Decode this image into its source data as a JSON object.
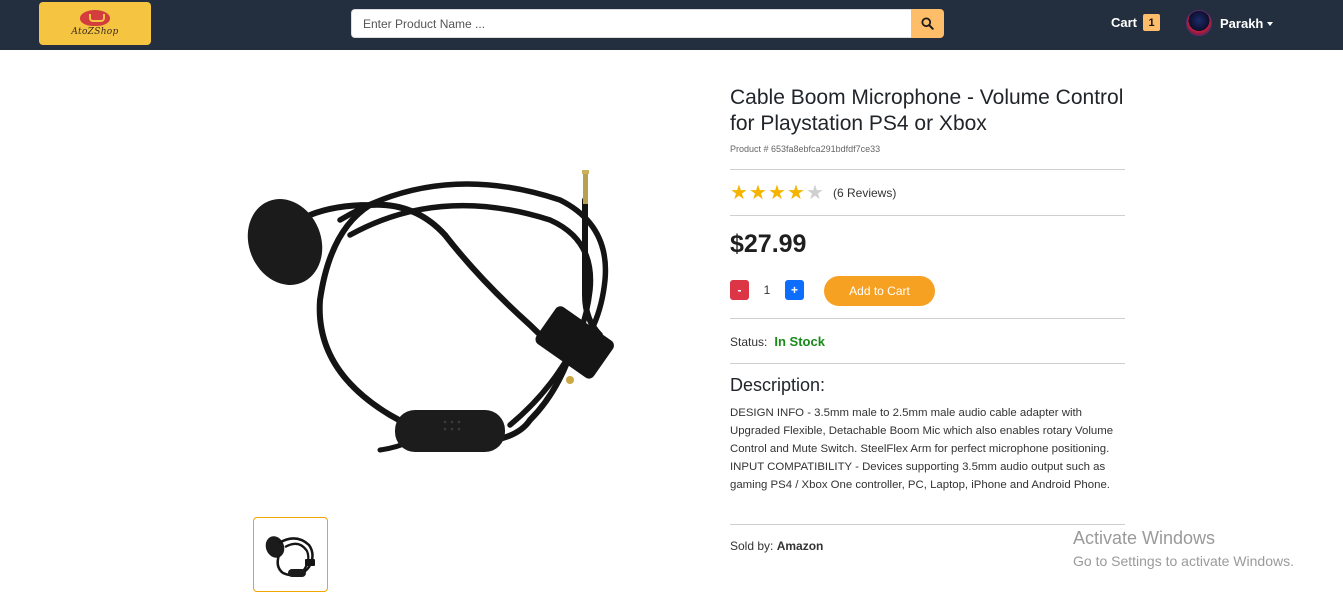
{
  "header": {
    "logo_text": "AtoZShop",
    "search_placeholder": "Enter Product Name ...",
    "cart_label": "Cart",
    "cart_count": "1",
    "user_name": "Parakh"
  },
  "product": {
    "title": "Cable Boom Microphone - Volume Control for Playstation PS4 or Xbox",
    "product_id": "Product # 653fa8ebfca291bdfdf7ce33",
    "rating": 4,
    "rating_max": 5,
    "reviews": "(6 Reviews)",
    "price": "$27.99",
    "minus_label": "-",
    "quantity": "1",
    "plus_label": "+",
    "add_to_cart_label": "Add to Cart",
    "status_label": "Status:",
    "status_value": "In Stock",
    "description_heading": "Description:",
    "description": "DESIGN INFO - 3.5mm male to 2.5mm male audio cable adapter with Upgraded Flexible, Detachable Boom Mic which also enables rotary Volume Control and Mute Switch. SteelFlex Arm for perfect microphone positioning. INPUT COMPATIBILITY - Devices supporting 3.5mm audio output such as gaming PS4 / Xbox One controller, PC, Laptop, iPhone and Android Phone.",
    "sold_by_label": "Sold by:",
    "sold_by_value": "Amazon"
  },
  "watermark": {
    "line1": "Activate Windows",
    "line2": "Go to Settings to activate Windows."
  },
  "colors": {
    "navbar": "#232f3e",
    "accent": "#febd69",
    "add_to_cart": "#f7a122",
    "in_stock": "#1a8a1a",
    "star": "#f4b400"
  }
}
